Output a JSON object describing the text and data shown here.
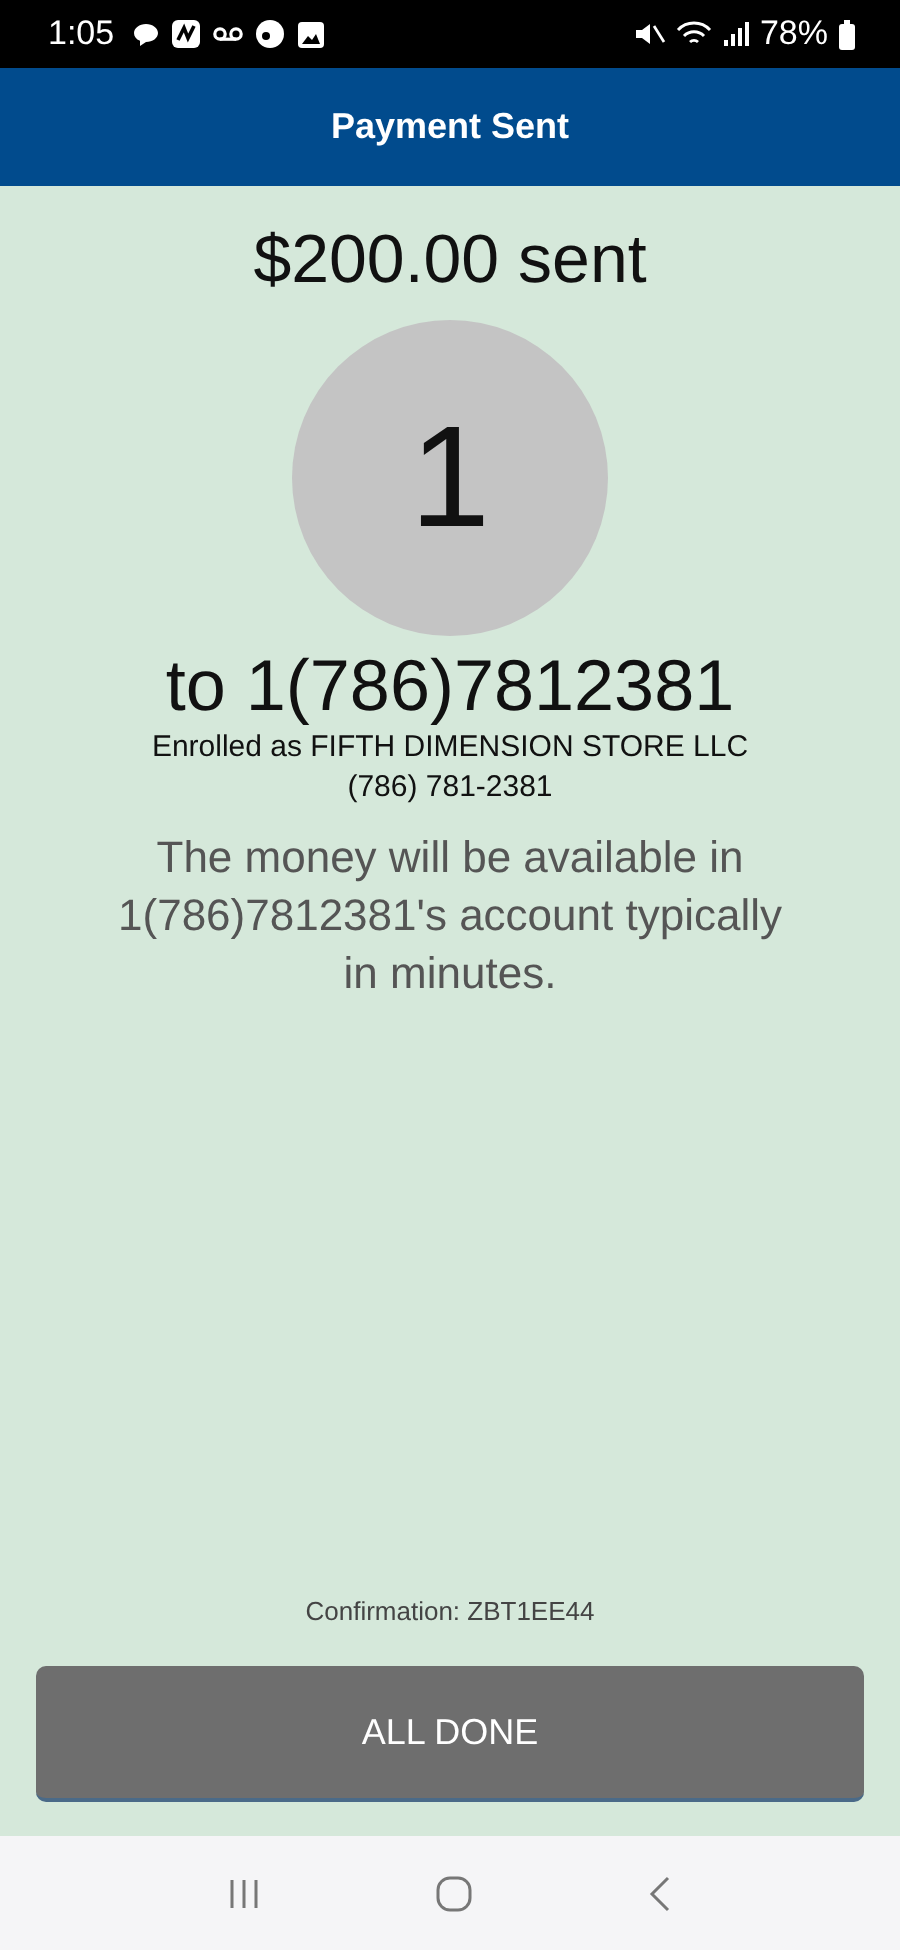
{
  "status_bar": {
    "time": "1:05",
    "battery": "78%"
  },
  "header": {
    "title": "Payment Sent"
  },
  "amount": "$200.00 sent",
  "avatar": {
    "initial": "1"
  },
  "recipient": "to 1(786)7812381",
  "enrolled": "Enrolled as FIFTH DIMENSION STORE LLC",
  "phone": "(786) 781-2381",
  "message": "The money will be available in 1(786)7812381's account typically in minutes.",
  "confirmation": "Confirmation: ZBT1EE44",
  "button": "ALL DONE"
}
